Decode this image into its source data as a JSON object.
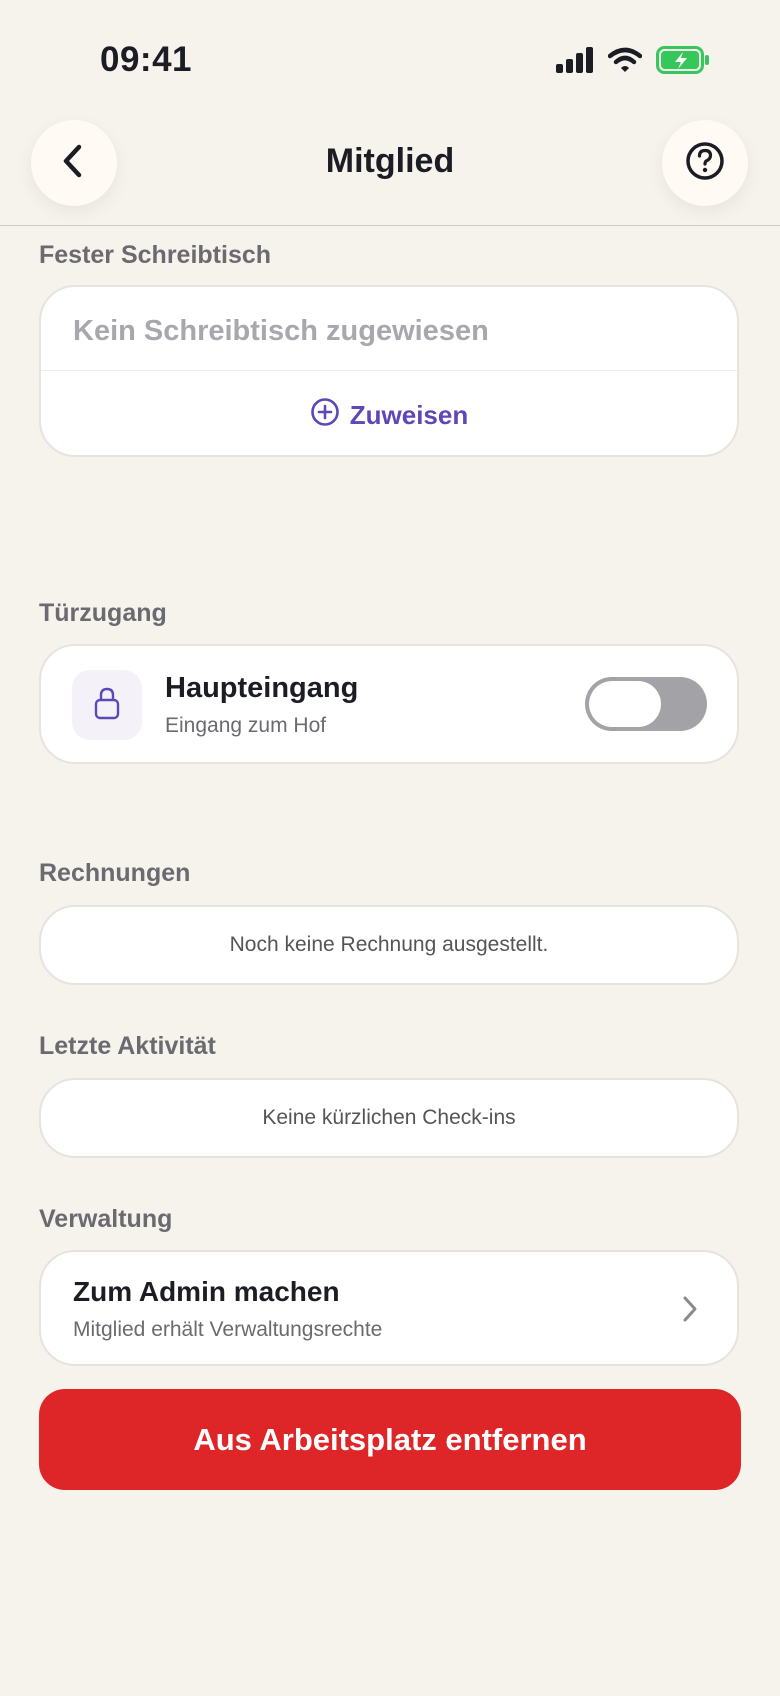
{
  "status_bar": {
    "time": "09:41",
    "icons": [
      "cellular-signal-icon",
      "wifi-icon",
      "battery-charging-icon"
    ],
    "battery_color": "#34C759"
  },
  "header": {
    "title": "Mitglied",
    "back_icon": "chevron-left-icon",
    "help_icon": "question-circle-icon"
  },
  "desk": {
    "label": "Fester Schreibtisch",
    "empty_text": "Kein Schreibtisch zugewiesen",
    "assign_label": "Zuweisen",
    "assign_icon": "plus-circle-icon"
  },
  "door_access": {
    "label": "Türzugang",
    "items": [
      {
        "title": "Haupteingang",
        "subtitle": "Eingang zum Hof",
        "icon": "lock-icon",
        "enabled": false
      }
    ]
  },
  "invoices": {
    "label": "Rechnungen",
    "empty_text": "Noch keine Rechnung ausgestellt."
  },
  "activity": {
    "label": "Letzte Aktivität",
    "empty_text": "Keine kürzlichen Check-ins"
  },
  "management": {
    "label": "Verwaltung",
    "admin_title": "Zum Admin machen",
    "admin_subtitle": "Mitglied erhält Verwaltungsrechte",
    "chevron_icon": "chevron-right-icon"
  },
  "remove_button": {
    "label": "Aus Arbeitsplatz entfernen",
    "color": "#DE2527"
  },
  "colors": {
    "background": "#F6F2EC",
    "accent": "#5E48B8",
    "danger": "#DE2527"
  }
}
